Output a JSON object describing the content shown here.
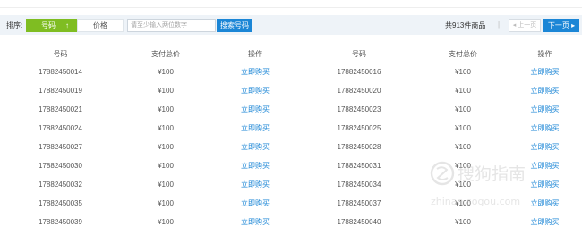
{
  "toolbar": {
    "sort_label": "排序:",
    "sort_code_label": "号码",
    "sort_code_arrow": "↑",
    "sort_price_label": "价格",
    "search_placeholder": "请至少输入两位数字",
    "search_button": "搜索号码",
    "total_text": "共913件商品",
    "separator": "|",
    "prev_label": "◂ 上一页",
    "next_label": "下一页 ▸"
  },
  "table": {
    "headers": [
      "号码",
      "支付总价",
      "操作",
      "号码",
      "支付总价",
      "操作"
    ],
    "rows": [
      {
        "left_number": "17882450014",
        "left_price": "¥100",
        "left_action": "立即购买",
        "right_number": "17882450016",
        "right_price": "¥100",
        "right_action": "立即购买"
      },
      {
        "left_number": "17882450019",
        "left_price": "¥100",
        "left_action": "立即购买",
        "right_number": "17882450020",
        "right_price": "¥100",
        "right_action": "立即购买"
      },
      {
        "left_number": "17882450021",
        "left_price": "¥100",
        "left_action": "立即购买",
        "right_number": "17882450023",
        "right_price": "¥100",
        "right_action": "立即购买"
      },
      {
        "left_number": "17882450024",
        "left_price": "¥100",
        "left_action": "立即购买",
        "right_number": "17882450025",
        "right_price": "¥100",
        "right_action": "立即购买"
      },
      {
        "left_number": "17882450027",
        "left_price": "¥100",
        "left_action": "立即购买",
        "right_number": "17882450028",
        "right_price": "¥100",
        "right_action": "立即购买"
      },
      {
        "left_number": "17882450030",
        "left_price": "¥100",
        "left_action": "立即购买",
        "right_number": "17882450031",
        "right_price": "¥100",
        "right_action": "立即购买"
      },
      {
        "left_number": "17882450032",
        "left_price": "¥100",
        "left_action": "立即购买",
        "right_number": "17882450034",
        "right_price": "¥100",
        "right_action": "立即购买"
      },
      {
        "left_number": "17882450035",
        "left_price": "¥100",
        "left_action": "立即购买",
        "right_number": "17882450037",
        "right_price": "¥100",
        "right_action": "立即购买"
      },
      {
        "left_number": "17882450039",
        "left_price": "¥100",
        "left_action": "立即购买",
        "right_number": "17882450040",
        "right_price": "¥100",
        "right_action": "立即购买"
      }
    ]
  },
  "watermark": {
    "text": "搜狗指南",
    "url": "zhinan.sogou.com"
  },
  "colors": {
    "accent_green": "#7fbd22",
    "accent_blue": "#1b86d6",
    "toolbar_bg": "#eef3f8"
  }
}
